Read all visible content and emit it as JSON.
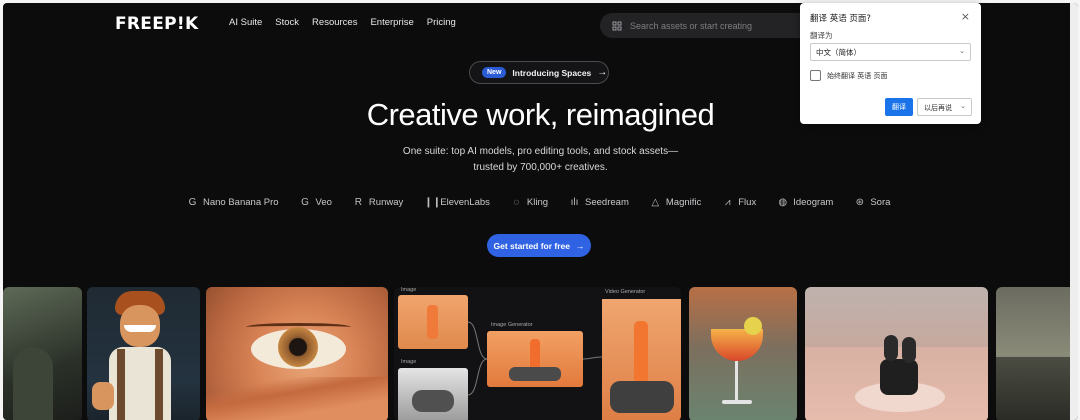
{
  "header": {
    "logo": "FREEP!K",
    "nav": [
      "AI Suite",
      "Stock",
      "Resources",
      "Enterprise",
      "Pricing"
    ],
    "search_placeholder": "Search assets or start creating"
  },
  "announcement": {
    "badge": "New",
    "text": "Introducing Spaces",
    "arrow": "→"
  },
  "hero": {
    "title": "Creative work, reimagined",
    "subtitle_line1": "One suite: top AI models, pro editing tools, and stock assets—",
    "subtitle_line2": "trusted by 700,000+ creatives."
  },
  "models": [
    {
      "icon": "google-icon",
      "glyph": "G",
      "label": "Nano Banana Pro"
    },
    {
      "icon": "google-icon",
      "glyph": "G",
      "label": "Veo"
    },
    {
      "icon": "runway-icon",
      "glyph": "R",
      "label": "Runway"
    },
    {
      "icon": "elevenlabs-icon",
      "glyph": "❙❙",
      "label": "ElevenLabs"
    },
    {
      "icon": "kling-icon",
      "glyph": "◌",
      "label": "Kling"
    },
    {
      "icon": "seedream-icon",
      "glyph": "ılı",
      "label": "Seedream"
    },
    {
      "icon": "magnific-icon",
      "glyph": "△",
      "label": "Magnific"
    },
    {
      "icon": "flux-icon",
      "glyph": "⩘",
      "label": "Flux"
    },
    {
      "icon": "ideogram-icon",
      "glyph": "◍",
      "label": "Ideogram"
    },
    {
      "icon": "sora-icon",
      "glyph": "⊛",
      "label": "Sora"
    }
  ],
  "cta": {
    "label": "Get started for free",
    "arrow": "→"
  },
  "gallery": {
    "node_image": "Image",
    "node_image_generator": "Image Generator",
    "node_image2": "Image",
    "node_video_generator": "Video Generator"
  },
  "translate_popup": {
    "title": "翻译 英语 页面?",
    "close": "×",
    "translate_to_label": "翻译为",
    "language": "中文（简体）",
    "always_translate": "始终翻译 英语 页面",
    "translate_button": "翻译",
    "later_button": "以后再说"
  },
  "colors": {
    "background": "#0c0c0d",
    "accent": "#2f63e3",
    "badge": "#2c5bd6"
  }
}
